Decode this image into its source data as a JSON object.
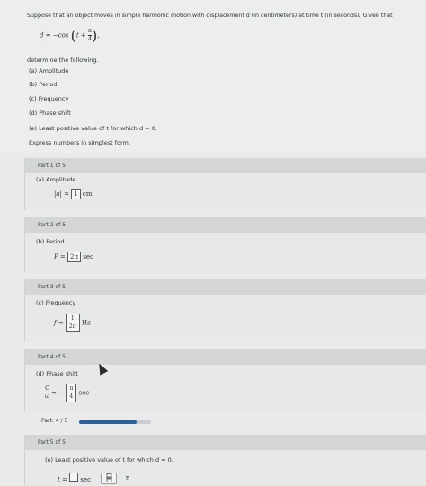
{
  "problem": {
    "intro": "Suppose that an object moves in simple harmonic motion with displacement d (in centimeters) at time t (in seconds). Given that",
    "equation_lhs": "d = −cos",
    "equation_arg_t": "t +",
    "equation_frac_num": "π",
    "equation_frac_den": "4",
    "determine": "determine the following.",
    "items": [
      "(a) Amplitude",
      "(b) Period",
      "(c) Frequency",
      "(d) Phase shift",
      "(e) Least positive value of t for which d = 0."
    ],
    "instruction": "Express numbers in simplest form."
  },
  "parts": [
    {
      "header": "Part 1 of 5",
      "label": "(a) Amplitude",
      "lhs": "|a| =",
      "answer": "1",
      "unit": "cm"
    },
    {
      "header": "Part 2 of 5",
      "label": "(b) Period",
      "lhs": "P =",
      "answer": "2π",
      "unit": "sec"
    },
    {
      "header": "Part 3 of 5",
      "label": "(c) Frequency",
      "lhs": "f =",
      "answer_num": "1",
      "answer_den": "2π",
      "unit": "Hz"
    },
    {
      "header": "Part 4 of 5",
      "label": "(d) Phase shift",
      "lhs_num": "C",
      "lhs_den": "ω",
      "eq": "=",
      "answer_sign": "−",
      "answer_num": "π",
      "answer_den": "4",
      "unit": "sec"
    },
    {
      "header": "Part 5 of 5",
      "label": "(e) Least positive value of t for which d = 0.",
      "lhs": "t =",
      "unit": "sec"
    }
  ],
  "progress": {
    "label": "Part: 4 / 5",
    "fraction": 0.8
  },
  "toolbar": {
    "fraction_icon": "fraction-icon",
    "pi_label": "π"
  },
  "colors": {
    "accent": "#2b5f9e",
    "header_bg": "#d3d6d5"
  }
}
